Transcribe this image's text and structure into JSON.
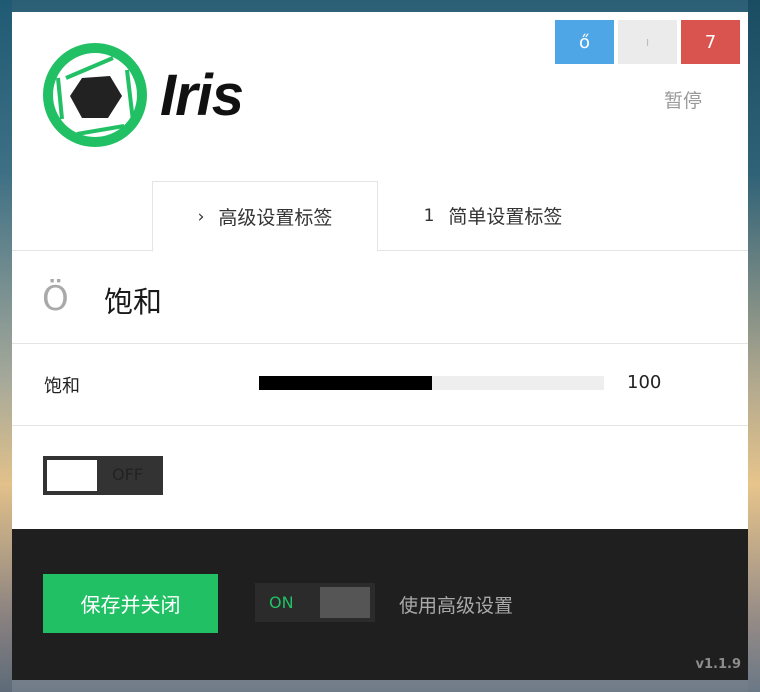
{
  "window": {
    "buttons": [
      {
        "label": "ő",
        "color": "#4ea6e6"
      },
      {
        "label": "ı",
        "color": "#ebebeb"
      },
      {
        "label": "7",
        "color": "#d9534f"
      }
    ],
    "pause_label": "暂停"
  },
  "logo": {
    "text": "Iris",
    "icon": "aperture-icon",
    "accent": "#22c065"
  },
  "tabs": [
    {
      "icon": "›",
      "label": "高级设置标签",
      "active": true
    },
    {
      "icon": "1",
      "label": "简单设置标签",
      "active": false
    }
  ],
  "section": {
    "icon": "Ö",
    "title": "饱和"
  },
  "slider": {
    "label": "饱和",
    "value": "100",
    "fill_fraction": 0.5
  },
  "toggle_off": {
    "label": "OFF"
  },
  "footer": {
    "save_label": "保存并关闭",
    "toggle_on_label": "ON",
    "advanced_label": "使用高级设置",
    "version": "v1.1.9"
  }
}
